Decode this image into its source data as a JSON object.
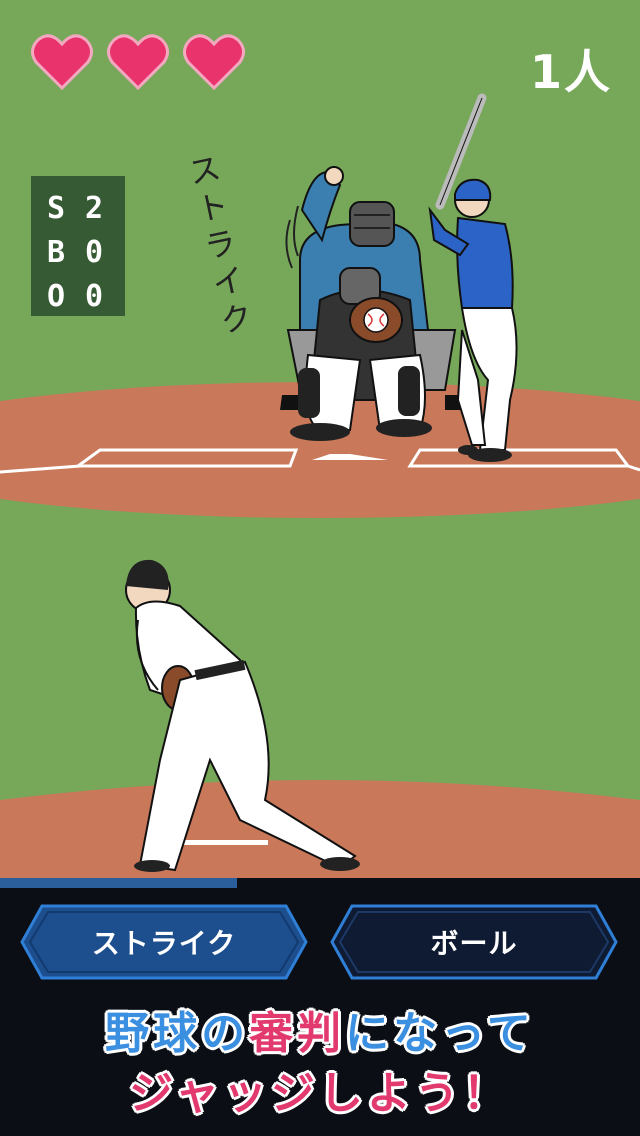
{
  "hud": {
    "lives": 3,
    "player_count": "1人",
    "heart_color": "#e8336d"
  },
  "scoreboard": {
    "rows": [
      {
        "label": "S",
        "value": "2"
      },
      {
        "label": "B",
        "value": "0"
      },
      {
        "label": "O",
        "value": "0"
      }
    ]
  },
  "scene": {
    "umpire_call": "ストライク",
    "field_color": "#77a85a",
    "dirt_color": "#c9785a"
  },
  "pitch_timer": {
    "progress": 0.37,
    "fill_color": "#2a5f9b"
  },
  "buttons": {
    "strike_label": "ストライク",
    "ball_label": "ボール",
    "strike_color": "#1d4e8e",
    "ball_color": "#0f1a33"
  },
  "promo": {
    "line1_a": "野球の",
    "line1_b": "審判",
    "line1_c": "になって",
    "line2": "ジャッジしよう！"
  }
}
